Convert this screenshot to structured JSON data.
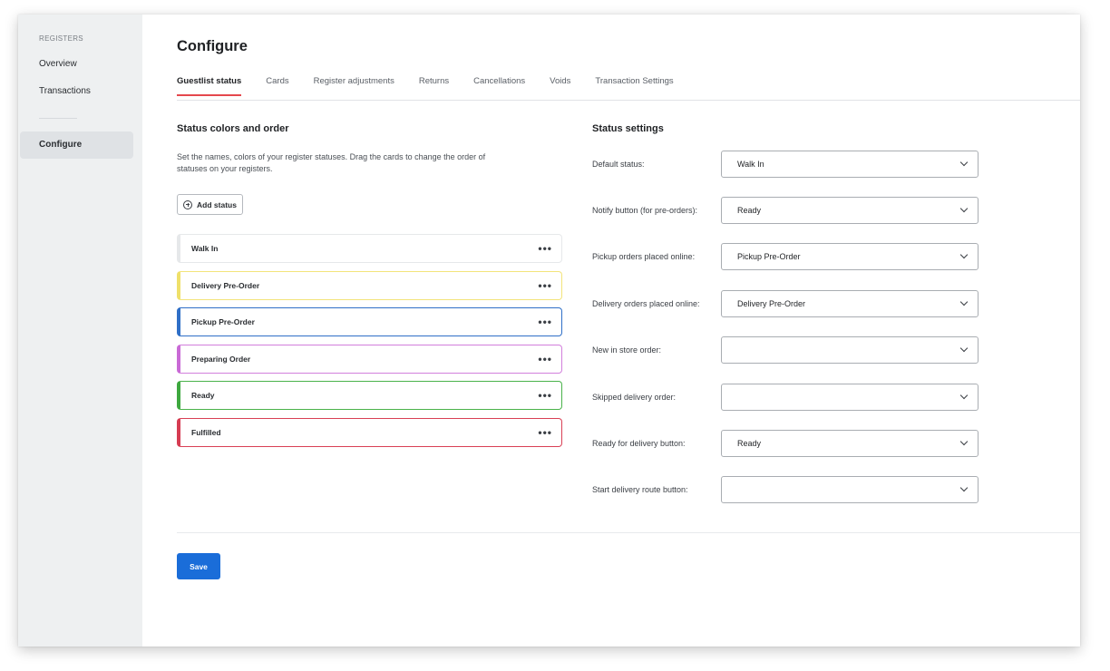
{
  "sidebar": {
    "heading": "REGISTERS",
    "items": [
      {
        "label": "Overview"
      },
      {
        "label": "Transactions"
      },
      {
        "label": "Configure"
      }
    ]
  },
  "page": {
    "title": "Configure"
  },
  "tabs": [
    {
      "label": "Guestlist status",
      "active": true
    },
    {
      "label": "Cards"
    },
    {
      "label": "Register adjustments"
    },
    {
      "label": "Returns"
    },
    {
      "label": "Cancellations"
    },
    {
      "label": "Voids"
    },
    {
      "label": "Transaction Settings"
    }
  ],
  "status_section": {
    "title": "Status colors and order",
    "description": "Set the names, colors of your register statuses. Drag the cards to change the order of statuses on your registers.",
    "add_button": "Add status",
    "statuses": [
      {
        "label": "Walk In",
        "color": "#e6e8ea",
        "accent": "#e6e8ea"
      },
      {
        "label": "Delivery Pre-Order",
        "color": "#f3e47a",
        "accent": "#efe06a"
      },
      {
        "label": "Pickup Pre-Order",
        "color": "#2f6fc7",
        "accent": "#2f6fc7"
      },
      {
        "label": "Preparing Order",
        "color": "#d27fdc",
        "accent": "#c96ad6"
      },
      {
        "label": "Ready",
        "color": "#49b24a",
        "accent": "#3ea83f"
      },
      {
        "label": "Fulfilled",
        "color": "#d94055",
        "accent": "#d63c52"
      }
    ]
  },
  "settings_section": {
    "title": "Status settings",
    "rows": [
      {
        "label": "Default status:",
        "value": "Walk In"
      },
      {
        "label": "Notify button (for pre-orders):",
        "value": "Ready"
      },
      {
        "label": "Pickup orders placed online:",
        "value": "Pickup Pre-Order"
      },
      {
        "label": "Delivery orders placed online:",
        "value": "Delivery Pre-Order"
      },
      {
        "label": "New in store order:",
        "value": ""
      },
      {
        "label": "Skipped delivery order:",
        "value": ""
      },
      {
        "label": "Ready for delivery button:",
        "value": "Ready"
      },
      {
        "label": "Start delivery route button:",
        "value": ""
      }
    ]
  },
  "actions": {
    "save_label": "Save"
  },
  "colors": {
    "accent": "#1a6dd9",
    "tab_underline": "#e5484d"
  }
}
